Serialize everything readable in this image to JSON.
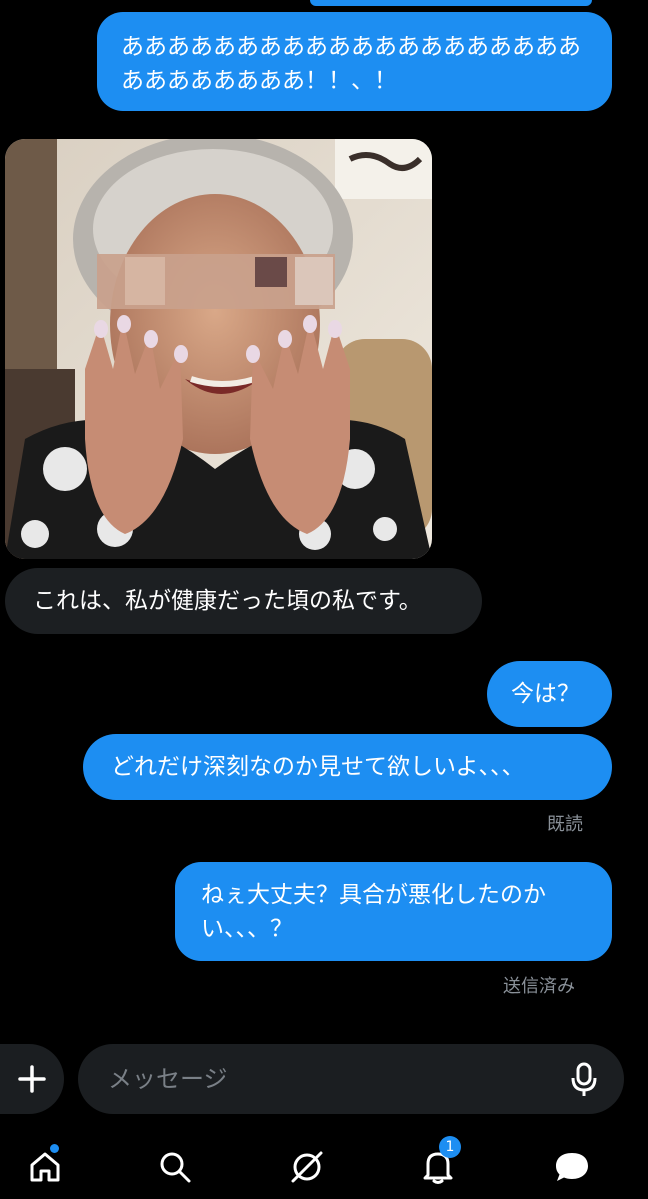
{
  "messages": [
    {
      "direction": "out",
      "text": "ああああああああああああああああああああああああああああ！！、！"
    },
    {
      "direction": "in",
      "type": "image",
      "image_icon": "photo-elderly-woman-blurred-face"
    },
    {
      "direction": "in",
      "text": "これは、私が健康だった頃の私です。"
    },
    {
      "direction": "out",
      "text": "今は？"
    },
    {
      "direction": "out",
      "text": "どれだけ深刻なのか見せて欲しいよ、、、",
      "status": "既読"
    },
    {
      "direction": "out",
      "text": "ねぇ大丈夫？具合が悪化したのかい、、、？",
      "status": "送信済み"
    }
  ],
  "composer": {
    "placeholder": "メッセージ",
    "add_icon": "plus-icon",
    "mic_icon": "microphone-icon"
  },
  "nav": {
    "items": [
      {
        "icon": "home-icon",
        "has_dot": true
      },
      {
        "icon": "search-icon"
      },
      {
        "icon": "grok-slash-icon"
      },
      {
        "icon": "bell-icon",
        "badge": "1"
      },
      {
        "icon": "messages-icon",
        "active": true
      }
    ]
  },
  "colors": {
    "outgoing_bubble": "#1d8ef2",
    "incoming_bubble": "#1c1f22",
    "background": "#000000",
    "meta_text": "#8a9199"
  }
}
